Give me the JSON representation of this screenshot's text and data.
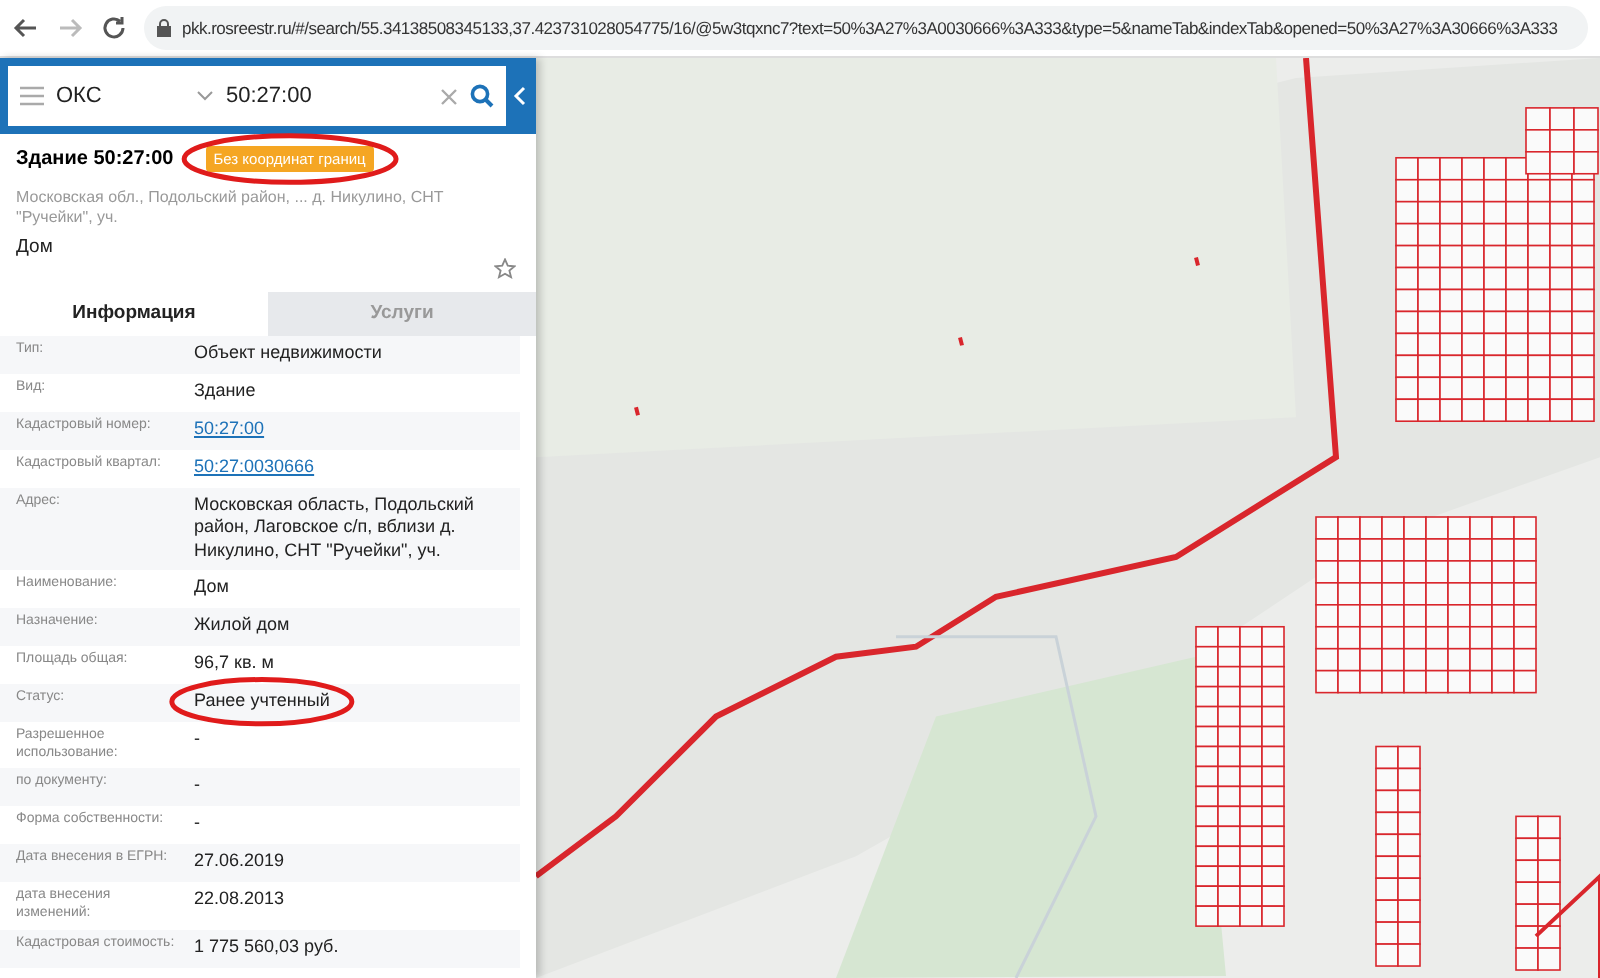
{
  "browser": {
    "url": "pkk.rosreestr.ru/#/search/55.34138508345133,37.423731028054775/16/@5w3tqxnc7?text=50%3A27%3A0030666%3A333&type=5&nameTab&indexTab&opened=50%3A27%3A30666%3A333"
  },
  "search": {
    "category": "ОКС",
    "value": "50:27:00"
  },
  "object": {
    "title": "Здание 50:27:00",
    "badge": "Без координат границ",
    "badge_circled": true,
    "address": "Московская обл., Подольский район, ... д. Никулино, СНТ \"Ручейки\", уч.",
    "type": "Дом"
  },
  "tabs": [
    {
      "label": "Информация",
      "selected": true
    },
    {
      "label": "Услуги",
      "selected": false
    }
  ],
  "rows": [
    {
      "label": "Тип:",
      "value": "Объект недвижимости",
      "kind": "text",
      "circled": false
    },
    {
      "label": "Вид:",
      "value": "Здание",
      "kind": "text",
      "circled": false
    },
    {
      "label": "Кадастровый номер:",
      "value": "50:27:00",
      "kind": "link",
      "circled": false
    },
    {
      "label": "Кадастровый квартал:",
      "value": "50:27:0030666",
      "kind": "link",
      "circled": false
    },
    {
      "label": "Адрес:",
      "value": "Московская область, Подольский район, Лаговское с/п, вблизи д. Никулино, СНТ \"Ручейки\", уч.",
      "kind": "text",
      "circled": false
    },
    {
      "label": "Наименование:",
      "value": "Дом",
      "kind": "text",
      "circled": false
    },
    {
      "label": "Назначение:",
      "value": "Жилой дом",
      "kind": "text",
      "circled": false
    },
    {
      "label": "Площадь общая:",
      "value": "96,7 кв. м",
      "kind": "text",
      "circled": false
    },
    {
      "label": "Статус:",
      "value": "Ранее учтенный",
      "kind": "text",
      "circled": true
    },
    {
      "label": "Разрешенное использование:",
      "value": "-",
      "kind": "text",
      "circled": false
    },
    {
      "label": "по документу:",
      "value": "-",
      "kind": "text",
      "circled": false
    },
    {
      "label": "Форма собственности:",
      "value": "-",
      "kind": "text",
      "circled": false
    },
    {
      "label": "Дата внесения в ЕГРН:",
      "value": "27.06.2019",
      "kind": "text",
      "circled": false
    },
    {
      "label": "дата внесения изменений:",
      "value": "22.08.2013",
      "kind": "text",
      "circled": false
    },
    {
      "label": "Кадастровая стоимость:",
      "value": "1 775 560,03 руб.",
      "kind": "text",
      "circled": false
    }
  ]
}
